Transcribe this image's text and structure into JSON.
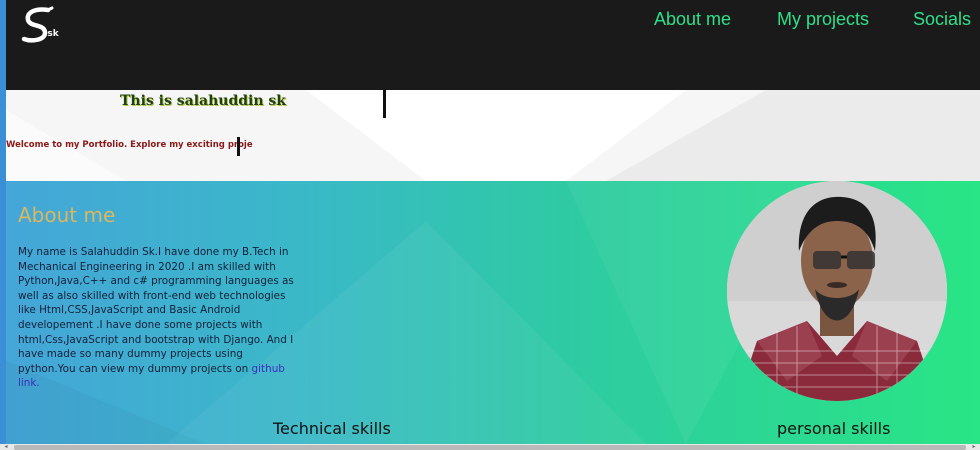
{
  "header": {
    "logo_text": "S",
    "logo_sub": ".sk",
    "nav": [
      "About me",
      "My projects",
      "Socials"
    ]
  },
  "intro": {
    "title": "This is salahuddin sk",
    "welcome": "Welcome to my Portfolio. Explore my exciting proje"
  },
  "about": {
    "heading": "About me",
    "body": "My name is Salahuddin Sk.I have done my B.Tech in Mechanical Engineering in 2020 .I am skilled with Python,Java,C++ and c# programming languages as well as also skilled with front-end web technologies like Html,CSS,JavaScript and Basic Android developement .I have done some projects with html,Css,JavaScript and bootstrap with Django. And I have made so many dummy projects using python.You can view my dummy projects on ",
    "link": "github link.",
    "skills": [
      "Technical skills",
      "personal skills"
    ]
  },
  "colors": {
    "header_bg": "#1a1a1a",
    "nav": "#2fe08a",
    "heading": "#d9b85f",
    "link": "#3b2fb8",
    "gradient_start": "#45a6d8",
    "gradient_end": "#29e585"
  },
  "icons": [
    "logo-icon",
    "profile-photo"
  ]
}
